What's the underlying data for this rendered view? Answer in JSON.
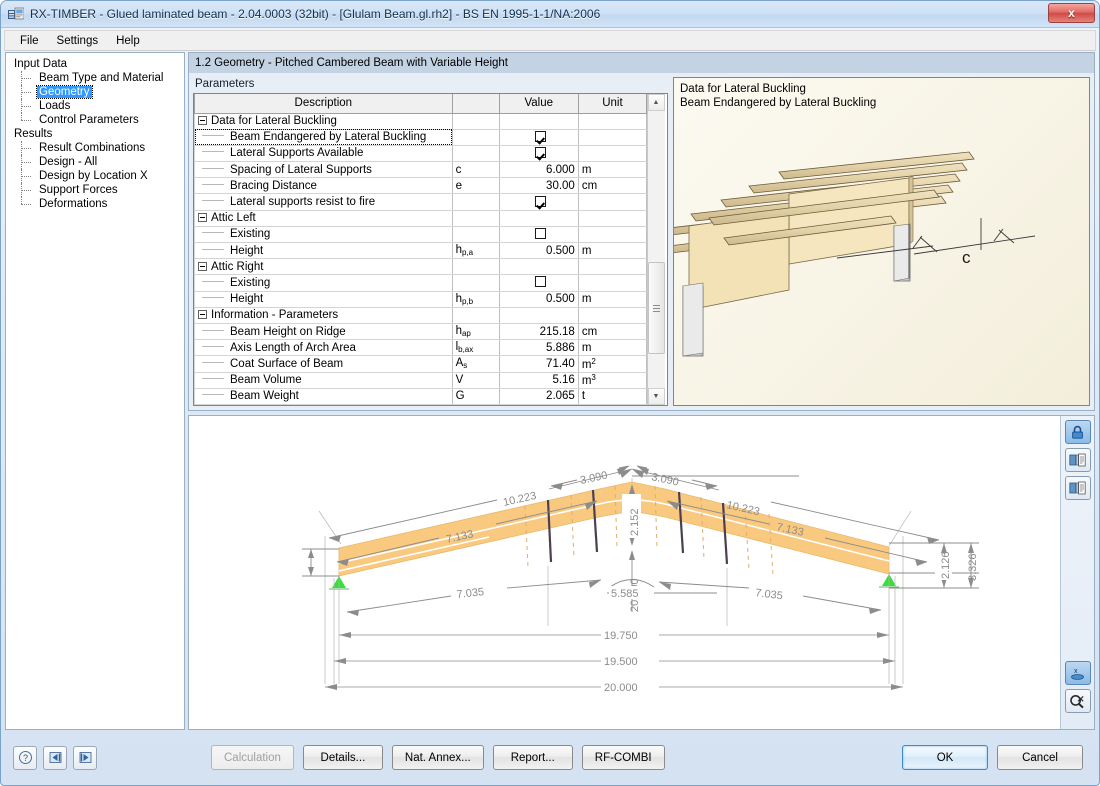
{
  "window": {
    "title": "RX-TIMBER - Glued laminated beam - 2.04.0003 (32bit) - [Glulam Beam.gl.rh2] - BS EN 1995-1-1/NA:2006",
    "close_label": "x"
  },
  "menu": {
    "items": [
      "File",
      "Settings",
      "Help"
    ]
  },
  "sidebar": {
    "groups": [
      {
        "label": "Input Data",
        "items": [
          {
            "label": "Beam Type and Material",
            "selected": false
          },
          {
            "label": "Geometry",
            "selected": true
          },
          {
            "label": "Loads",
            "selected": false
          },
          {
            "label": "Control Parameters",
            "selected": false
          }
        ]
      },
      {
        "label": "Results",
        "items": [
          {
            "label": "Result Combinations",
            "selected": false
          },
          {
            "label": "Design - All",
            "selected": false
          },
          {
            "label": "Design by Location X",
            "selected": false
          },
          {
            "label": "Support Forces",
            "selected": false
          },
          {
            "label": "Deformations",
            "selected": false
          }
        ]
      }
    ]
  },
  "page": {
    "header": "1.2 Geometry  -  Pitched Cambered Beam with Variable Height"
  },
  "parameters": {
    "title": "Parameters",
    "columns": [
      "Description",
      "",
      "Value",
      "Unit"
    ],
    "rows": [
      {
        "type": "group",
        "desc": "Data for Lateral Buckling"
      },
      {
        "type": "check",
        "desc": "Beam Endangered by Lateral Buckling",
        "sym": "",
        "checked": true,
        "unit": "",
        "selected": true
      },
      {
        "type": "check",
        "desc": "Lateral Supports Available",
        "sym": "",
        "checked": true,
        "unit": ""
      },
      {
        "type": "value",
        "desc": "Spacing of Lateral Supports",
        "sym": "c",
        "value": "6.000",
        "unit": "m"
      },
      {
        "type": "value",
        "desc": "Bracing Distance",
        "sym": "e",
        "value": "30.00",
        "unit": "cm"
      },
      {
        "type": "check",
        "desc": "Lateral supports resist to fire",
        "sym": "",
        "checked": true,
        "unit": ""
      },
      {
        "type": "group",
        "desc": "Attic Left"
      },
      {
        "type": "check",
        "desc": "Existing",
        "sym": "",
        "checked": false,
        "unit": ""
      },
      {
        "type": "value",
        "desc": "Height",
        "sym": "h",
        "sym_sub": "p,a",
        "value": "0.500",
        "unit": "m"
      },
      {
        "type": "group",
        "desc": "Attic Right"
      },
      {
        "type": "check",
        "desc": "Existing",
        "sym": "",
        "checked": false,
        "unit": ""
      },
      {
        "type": "value",
        "desc": "Height",
        "sym": "h",
        "sym_sub": "p,b",
        "value": "0.500",
        "unit": "m"
      },
      {
        "type": "group",
        "desc": "Information - Parameters"
      },
      {
        "type": "value",
        "desc": "Beam Height on Ridge",
        "sym": "h",
        "sym_sub": "ap",
        "value": "215.18",
        "unit": "cm"
      },
      {
        "type": "value",
        "desc": "Axis Length of Arch Area",
        "sym": "l",
        "sym_sub": "b,ax",
        "value": "5.886",
        "unit": "m"
      },
      {
        "type": "value",
        "desc": "Coat Surface of Beam",
        "sym": "A",
        "sym_sub": "s",
        "value": "71.40",
        "unit": "m",
        "unit_sup": "2"
      },
      {
        "type": "value",
        "desc": "Beam Volume",
        "sym": "V",
        "value": "5.16",
        "unit": "m",
        "unit_sup": "3"
      },
      {
        "type": "value",
        "desc": "Beam Weight",
        "sym": "G",
        "value": "2.065",
        "unit": "t"
      }
    ]
  },
  "picture": {
    "caption_line1": "Data for Lateral Buckling",
    "caption_line2": "Beam Endangered by Lateral Buckling",
    "dimension_label": "c"
  },
  "drawing": {
    "dimensions": {
      "top_left_outer": "10.223",
      "top_left_inner": "7.133",
      "ridge_left": "3.090",
      "ridge_right": "3.090",
      "top_right_outer": "10.223",
      "top_right_inner": "7.133",
      "ridge_height": "2.152",
      "radius": "20.000",
      "right_height_inner": "2.126",
      "right_height_outer": "3.326",
      "bottom_left_chord": "7.035",
      "bottom_arc": "5.585",
      "bottom_right_chord": "7.035",
      "span_1": "19.750",
      "span_2": "19.500",
      "span_3": "20.000"
    },
    "tools": [
      {
        "name": "lock-icon",
        "active": true
      },
      {
        "name": "copy-to-clipboard-icon",
        "active": false
      },
      {
        "name": "copy-picture-icon",
        "active": false
      },
      {
        "name": "x-axis-view-icon",
        "active": true
      },
      {
        "name": "zoom-reset-icon",
        "active": false
      }
    ]
  },
  "footer": {
    "icon_buttons": [
      "help-icon",
      "previous-step-icon",
      "next-step-icon"
    ],
    "buttons": [
      {
        "label": "Calculation",
        "disabled": true
      },
      {
        "label": "Details...",
        "disabled": false
      },
      {
        "label": "Nat. Annex...",
        "disabled": false
      },
      {
        "label": "Report...",
        "disabled": false
      },
      {
        "label": "RF-COMBI",
        "disabled": false
      }
    ],
    "ok_label": "OK",
    "cancel_label": "Cancel"
  },
  "colors": {
    "beam_fill": "#fac980",
    "accent_selection": "#3399ff",
    "support_green": "#33dd33",
    "dimension_gray": "#8c8c8c"
  }
}
